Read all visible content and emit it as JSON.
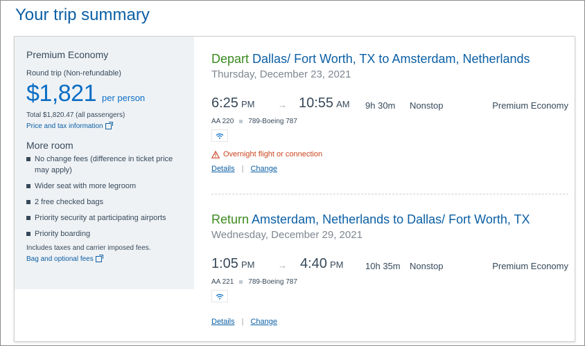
{
  "page": {
    "title": "Your trip summary"
  },
  "summary": {
    "cabin": "Premium Economy",
    "trip_type": "Round trip (Non-refundable)",
    "price": "$1,821",
    "per_person": "per person",
    "total": "Total $1,820.47 (all passengers)",
    "price_tax_link": "Price and tax information",
    "more_room_title": "More room",
    "perks": [
      "No change fees (difference in ticket price may apply)",
      "Wider seat with more legroom",
      "2 free checked bags",
      "Priority security at participating airports",
      "Priority boarding"
    ],
    "includes": "Includes taxes and carrier imposed fees.",
    "bag_link": "Bag and optional fees"
  },
  "depart": {
    "direction": "Depart",
    "route": "Dallas/ Fort Worth, TX to Amsterdam, Netherlands",
    "date": "Thursday, December 23, 2021",
    "dep_time": "6:25",
    "dep_ampm": "PM",
    "arr_time": "10:55",
    "arr_ampm": "AM",
    "dur_h": "9h",
    "dur_m": "30m",
    "stops": "Nonstop",
    "fare": "Premium Economy",
    "flight": "AA 220",
    "aircraft": "789-Boeing 787",
    "warning": "Overnight flight or connection",
    "details": "Details",
    "change": "Change"
  },
  "return": {
    "direction": "Return",
    "route": "Amsterdam, Netherlands to Dallas/ Fort Worth, TX",
    "date": "Wednesday, December 29, 2021",
    "dep_time": "1:05",
    "dep_ampm": "PM",
    "arr_time": "4:40",
    "arr_ampm": "PM",
    "dur_h": "10h",
    "dur_m": "35m",
    "stops": "Nonstop",
    "fare": "Premium Economy",
    "flight": "AA 221",
    "aircraft": "789-Boeing 787",
    "details": "Details",
    "change": "Change"
  },
  "icons": {
    "wifi": "wifi-icon",
    "warning": "warning-triangle-icon",
    "external": "external-link-icon",
    "arrow": "arrow-right-icon"
  },
  "colors": {
    "accent_blue": "#0b5fa5",
    "price_blue": "#0b6ec5",
    "direction_green": "#3a8a1e",
    "warning_orange": "#c9441e"
  }
}
